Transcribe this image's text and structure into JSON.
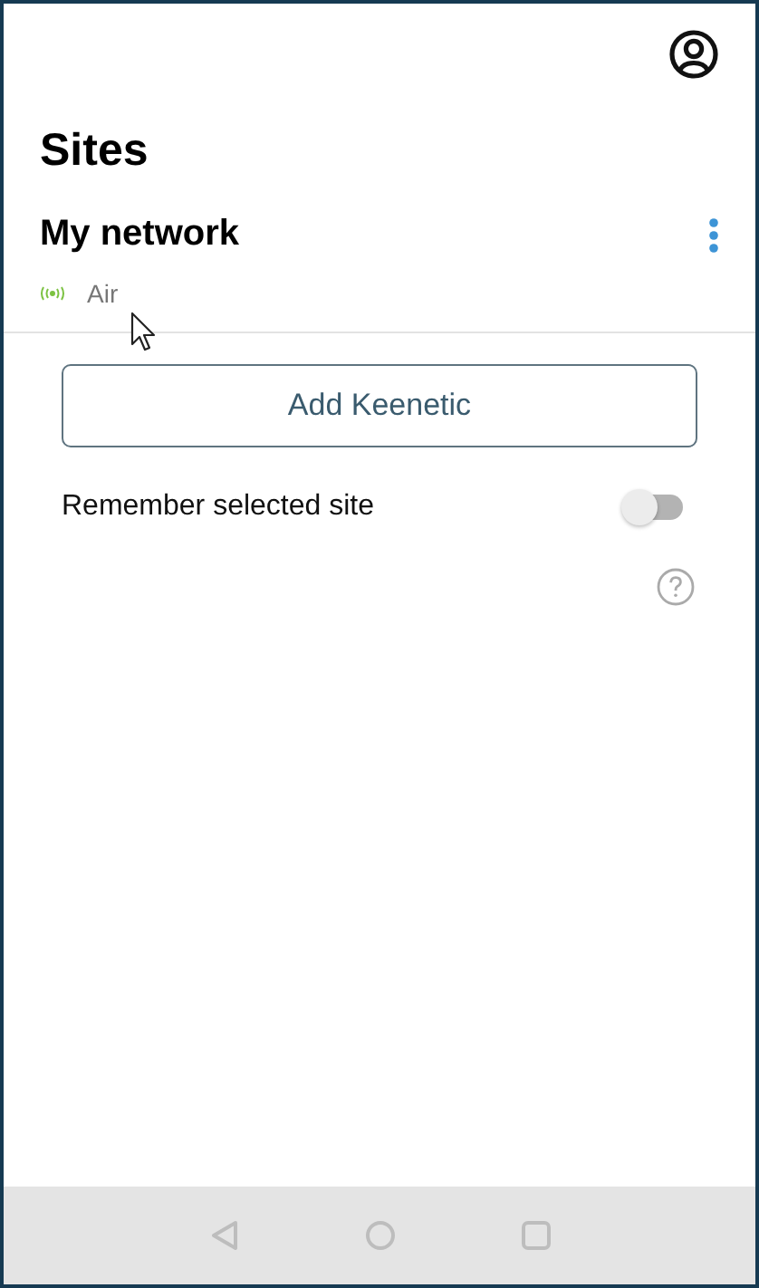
{
  "header": {
    "title": "Sites"
  },
  "sites": [
    {
      "name": "My network",
      "model": "Air",
      "online": true
    }
  ],
  "add_button": "Add Keenetic",
  "remember_setting": {
    "label": "Remember selected site",
    "on": false
  }
}
